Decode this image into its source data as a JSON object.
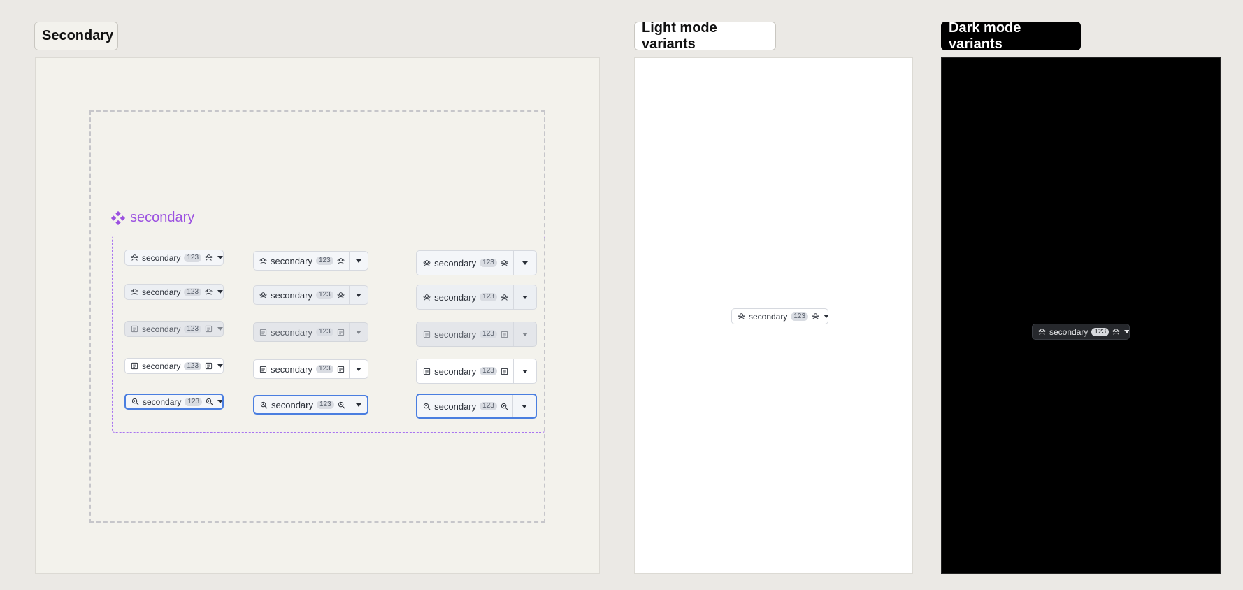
{
  "sections": {
    "secondary": "Secondary",
    "light": "Light mode variants",
    "dark": "Dark mode variants"
  },
  "component": {
    "name": "secondary",
    "accent_color": "#9b51e0",
    "label": "secondary",
    "badge": "123"
  },
  "grid": {
    "states": [
      "default",
      "hover",
      "disabled",
      "rest",
      "focus"
    ],
    "sizes": [
      "small",
      "medium",
      "large"
    ],
    "icons": [
      "user-group-icon",
      "user-group-icon",
      "list-box-icon",
      "list-box-icon",
      "zoom-icon"
    ]
  },
  "light_variant": {
    "label": "secondary",
    "badge": "123"
  },
  "dark_variant": {
    "label": "secondary",
    "badge": "123"
  },
  "colors": {
    "page_bg": "#ebe9e5",
    "canvas_bg": "#f3f2ec",
    "focus_ring": "#4a7ee0",
    "dark_bg": "#000000"
  }
}
